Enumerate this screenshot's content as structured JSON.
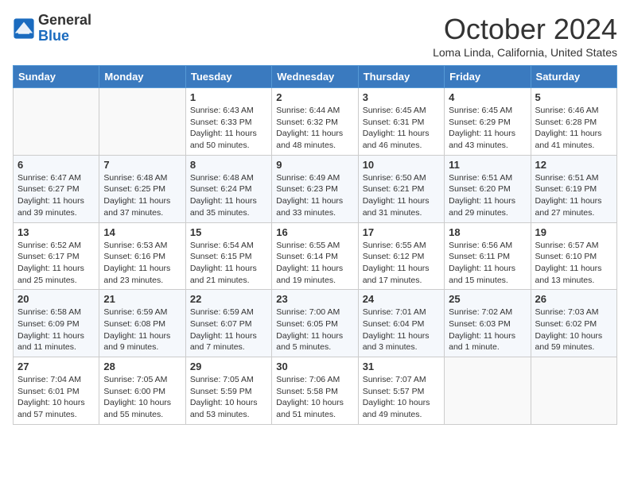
{
  "header": {
    "logo_general": "General",
    "logo_blue": "Blue",
    "month_title": "October 2024",
    "location": "Loma Linda, California, United States"
  },
  "days_of_week": [
    "Sunday",
    "Monday",
    "Tuesday",
    "Wednesday",
    "Thursday",
    "Friday",
    "Saturday"
  ],
  "weeks": [
    [
      {
        "day": "",
        "info": ""
      },
      {
        "day": "",
        "info": ""
      },
      {
        "day": "1",
        "info": "Sunrise: 6:43 AM\nSunset: 6:33 PM\nDaylight: 11 hours and 50 minutes."
      },
      {
        "day": "2",
        "info": "Sunrise: 6:44 AM\nSunset: 6:32 PM\nDaylight: 11 hours and 48 minutes."
      },
      {
        "day": "3",
        "info": "Sunrise: 6:45 AM\nSunset: 6:31 PM\nDaylight: 11 hours and 46 minutes."
      },
      {
        "day": "4",
        "info": "Sunrise: 6:45 AM\nSunset: 6:29 PM\nDaylight: 11 hours and 43 minutes."
      },
      {
        "day": "5",
        "info": "Sunrise: 6:46 AM\nSunset: 6:28 PM\nDaylight: 11 hours and 41 minutes."
      }
    ],
    [
      {
        "day": "6",
        "info": "Sunrise: 6:47 AM\nSunset: 6:27 PM\nDaylight: 11 hours and 39 minutes."
      },
      {
        "day": "7",
        "info": "Sunrise: 6:48 AM\nSunset: 6:25 PM\nDaylight: 11 hours and 37 minutes."
      },
      {
        "day": "8",
        "info": "Sunrise: 6:48 AM\nSunset: 6:24 PM\nDaylight: 11 hours and 35 minutes."
      },
      {
        "day": "9",
        "info": "Sunrise: 6:49 AM\nSunset: 6:23 PM\nDaylight: 11 hours and 33 minutes."
      },
      {
        "day": "10",
        "info": "Sunrise: 6:50 AM\nSunset: 6:21 PM\nDaylight: 11 hours and 31 minutes."
      },
      {
        "day": "11",
        "info": "Sunrise: 6:51 AM\nSunset: 6:20 PM\nDaylight: 11 hours and 29 minutes."
      },
      {
        "day": "12",
        "info": "Sunrise: 6:51 AM\nSunset: 6:19 PM\nDaylight: 11 hours and 27 minutes."
      }
    ],
    [
      {
        "day": "13",
        "info": "Sunrise: 6:52 AM\nSunset: 6:17 PM\nDaylight: 11 hours and 25 minutes."
      },
      {
        "day": "14",
        "info": "Sunrise: 6:53 AM\nSunset: 6:16 PM\nDaylight: 11 hours and 23 minutes."
      },
      {
        "day": "15",
        "info": "Sunrise: 6:54 AM\nSunset: 6:15 PM\nDaylight: 11 hours and 21 minutes."
      },
      {
        "day": "16",
        "info": "Sunrise: 6:55 AM\nSunset: 6:14 PM\nDaylight: 11 hours and 19 minutes."
      },
      {
        "day": "17",
        "info": "Sunrise: 6:55 AM\nSunset: 6:12 PM\nDaylight: 11 hours and 17 minutes."
      },
      {
        "day": "18",
        "info": "Sunrise: 6:56 AM\nSunset: 6:11 PM\nDaylight: 11 hours and 15 minutes."
      },
      {
        "day": "19",
        "info": "Sunrise: 6:57 AM\nSunset: 6:10 PM\nDaylight: 11 hours and 13 minutes."
      }
    ],
    [
      {
        "day": "20",
        "info": "Sunrise: 6:58 AM\nSunset: 6:09 PM\nDaylight: 11 hours and 11 minutes."
      },
      {
        "day": "21",
        "info": "Sunrise: 6:59 AM\nSunset: 6:08 PM\nDaylight: 11 hours and 9 minutes."
      },
      {
        "day": "22",
        "info": "Sunrise: 6:59 AM\nSunset: 6:07 PM\nDaylight: 11 hours and 7 minutes."
      },
      {
        "day": "23",
        "info": "Sunrise: 7:00 AM\nSunset: 6:05 PM\nDaylight: 11 hours and 5 minutes."
      },
      {
        "day": "24",
        "info": "Sunrise: 7:01 AM\nSunset: 6:04 PM\nDaylight: 11 hours and 3 minutes."
      },
      {
        "day": "25",
        "info": "Sunrise: 7:02 AM\nSunset: 6:03 PM\nDaylight: 11 hours and 1 minute."
      },
      {
        "day": "26",
        "info": "Sunrise: 7:03 AM\nSunset: 6:02 PM\nDaylight: 10 hours and 59 minutes."
      }
    ],
    [
      {
        "day": "27",
        "info": "Sunrise: 7:04 AM\nSunset: 6:01 PM\nDaylight: 10 hours and 57 minutes."
      },
      {
        "day": "28",
        "info": "Sunrise: 7:05 AM\nSunset: 6:00 PM\nDaylight: 10 hours and 55 minutes."
      },
      {
        "day": "29",
        "info": "Sunrise: 7:05 AM\nSunset: 5:59 PM\nDaylight: 10 hours and 53 minutes."
      },
      {
        "day": "30",
        "info": "Sunrise: 7:06 AM\nSunset: 5:58 PM\nDaylight: 10 hours and 51 minutes."
      },
      {
        "day": "31",
        "info": "Sunrise: 7:07 AM\nSunset: 5:57 PM\nDaylight: 10 hours and 49 minutes."
      },
      {
        "day": "",
        "info": ""
      },
      {
        "day": "",
        "info": ""
      }
    ]
  ]
}
